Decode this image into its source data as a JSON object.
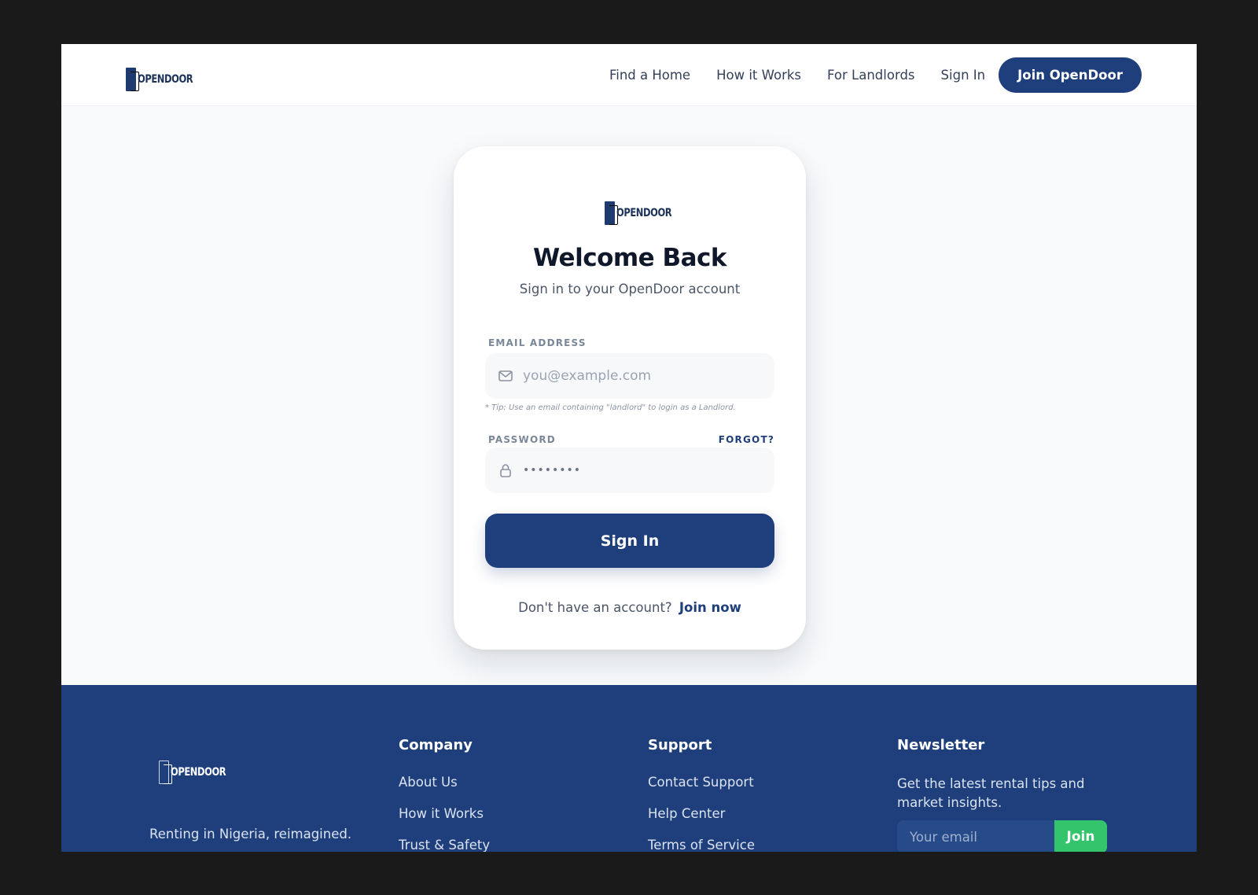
{
  "brand": {
    "name": "OPENDOOR",
    "primary_color": "#1e3f7c",
    "accent_color": "#34c46b"
  },
  "nav": {
    "links": [
      "Find a Home",
      "How it Works",
      "For Landlords",
      "Sign In"
    ],
    "cta": "Join OpenDoor"
  },
  "login": {
    "title": "Welcome Back",
    "subtitle": "Sign in to your OpenDoor account",
    "email_label": "EMAIL ADDRESS",
    "email_placeholder": "you@example.com",
    "email_icon": "mail-icon",
    "tip": "* Tip: Use an email containing \"landlord\" to login as a Landlord.",
    "password_label": "PASSWORD",
    "forgot_label": "FORGOT?",
    "password_icon": "lock-icon",
    "password_value": "••••••••",
    "submit_label": "Sign In",
    "signup_prompt": "Don't have an account?",
    "signup_link": "Join now"
  },
  "footer": {
    "tagline": "Renting in Nigeria, reimagined.",
    "company": {
      "title": "Company",
      "links": [
        "About Us",
        "How it Works",
        "Trust & Safety"
      ]
    },
    "support": {
      "title": "Support",
      "links": [
        "Contact Support",
        "Help Center",
        "Terms of Service"
      ]
    },
    "newsletter": {
      "title": "Newsletter",
      "text": "Get the latest rental tips and market insights.",
      "placeholder": "Your email",
      "button": "Join"
    }
  }
}
